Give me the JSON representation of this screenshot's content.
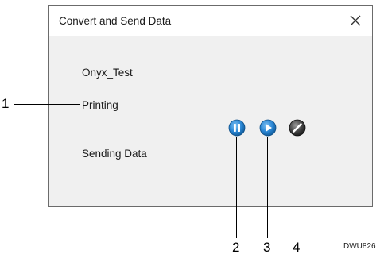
{
  "dialog": {
    "title": "Convert and Send Data",
    "close_icon": "close-icon",
    "document_name": "Onyx_Test",
    "status": "Printing",
    "sending_label": "Sending Data"
  },
  "controls": [
    {
      "icon": "pause-icon",
      "color": "#1f78c8"
    },
    {
      "icon": "play-icon",
      "color": "#1f78c8"
    },
    {
      "icon": "cancel-icon",
      "color": "#3a3a3a"
    }
  ],
  "callouts": {
    "c1": "1",
    "c2": "2",
    "c3": "3",
    "c4": "4"
  },
  "figure_code": "DWU826"
}
